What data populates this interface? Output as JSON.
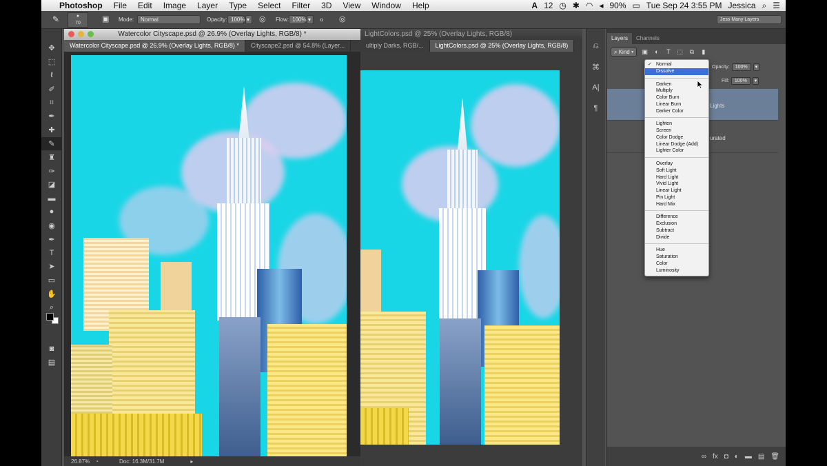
{
  "menubar": {
    "app": "Photoshop",
    "items": [
      "File",
      "Edit",
      "Image",
      "Layer",
      "Type",
      "Select",
      "Filter",
      "3D",
      "View",
      "Window",
      "Help"
    ],
    "status": {
      "adobe_badge": "12",
      "battery": "90%",
      "datetime": "Tue Sep 24  3:55 PM",
      "user": "Jessica"
    }
  },
  "options": {
    "brush_size": "70",
    "mode_label": "Mode:",
    "mode_value": "Normal",
    "opacity_label": "Opacity:",
    "opacity_value": "100%",
    "flow_label": "Flow:",
    "flow_value": "100%",
    "workspace": "Jess Many Layers"
  },
  "doc1": {
    "title": "Watercolor Cityscape.psd @ 26.9% (Overlay Lights, RGB/8) *",
    "tabs": [
      "Watercolor Cityscape.psd @ 26.9% (Overlay Lights, RGB/8) *",
      "Cityscape2.psd @ 54.8% (Layer..."
    ],
    "zoom": "26.87%",
    "doc_size": "Doc: 16.3M/31.7M"
  },
  "doc2": {
    "title": "LightColors.psd @ 25% (Overlay Lights, RGB/8)",
    "tabs": [
      "ultiply Darks, RGB/...",
      "LightColors.psd @ 25% (Overlay Lights, RGB/8)"
    ]
  },
  "layers_panel": {
    "tabs": [
      "Layers",
      "Channels"
    ],
    "kind_label": "Kind",
    "opacity_label": "Opacity:",
    "opacity_value": "100%",
    "fill_label": "Fill:",
    "fill_value": "100%",
    "layer_rows": [
      "Lights",
      "urated"
    ]
  },
  "blend_menu": {
    "checked": "Normal",
    "highlighted": "Dissolve",
    "groups": [
      [
        "Normal",
        "Dissolve"
      ],
      [
        "Darken",
        "Multiply",
        "Color Burn",
        "Linear Burn",
        "Darker Color"
      ],
      [
        "Lighten",
        "Screen",
        "Color Dodge",
        "Linear Dodge (Add)",
        "Lighter Color"
      ],
      [
        "Overlay",
        "Soft Light",
        "Hard Light",
        "Vivid Light",
        "Linear Light",
        "Pin Light",
        "Hard Mix"
      ],
      [
        "Difference",
        "Exclusion",
        "Subtract",
        "Divide"
      ],
      [
        "Hue",
        "Saturation",
        "Color",
        "Luminosity"
      ]
    ]
  },
  "colors": {
    "sky": "#19d6e6",
    "highlight": "#3d6fd8",
    "layer_selected": "#6c7f99"
  }
}
